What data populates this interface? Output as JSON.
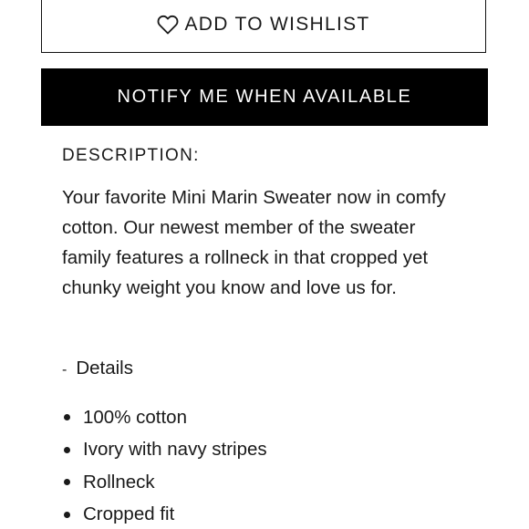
{
  "actions": {
    "wishlist_label": "ADD TO WISHLIST",
    "notify_label": "NOTIFY ME WHEN AVAILABLE"
  },
  "description": {
    "heading": "DESCRIPTION:",
    "body": "Your favorite Mini Marin Sweater now in comfy cotton. Our newest member of the sweater family features a rollneck in that cropped yet chunky weight you know and love us for."
  },
  "details": {
    "toggle_symbol": "-",
    "toggle_label": "Details",
    "items": [
      "100% cotton",
      "Ivory with navy stripes",
      "Rollneck",
      "Cropped fit"
    ]
  },
  "icons": {
    "wishlist": "heart-icon"
  },
  "colors": {
    "notify_bg": "#000000",
    "notify_text": "#ffffff",
    "text": "#1a1a1a"
  }
}
